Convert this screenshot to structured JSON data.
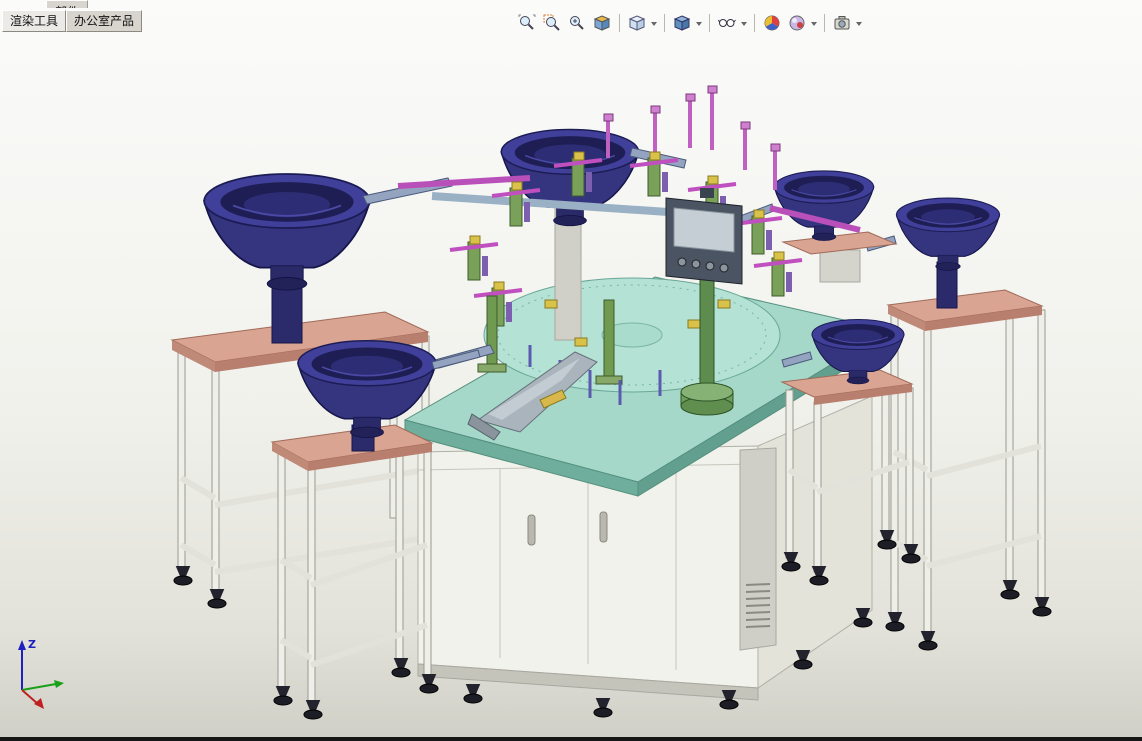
{
  "tabs": [
    {
      "label": "渲染工具"
    },
    {
      "label": "办公室产品"
    }
  ],
  "top_fragment": {
    "label": "部件"
  },
  "toolbar": {
    "items": [
      {
        "name": "zoom-to-fit-icon",
        "glyph": "magnifier"
      },
      {
        "name": "zoom-to-area-icon",
        "glyph": "magnifier-with-area"
      },
      {
        "name": "zoom-in-out-icon",
        "glyph": "magnifier-with-plus"
      },
      {
        "name": "section-view-icon",
        "glyph": "cube-cut"
      },
      {
        "name": "view-orientation-icon",
        "glyph": "cube",
        "dropdown": true
      },
      {
        "name": "display-style-icon",
        "glyph": "shaded-cube",
        "dropdown": true
      },
      {
        "name": "hide-show-items-icon",
        "glyph": "glasses",
        "dropdown": true
      },
      {
        "name": "edit-appearance-icon",
        "glyph": "color-sphere"
      },
      {
        "name": "apply-scene-icon",
        "glyph": "scene-sphere",
        "dropdown": true
      },
      {
        "name": "view-settings-icon",
        "glyph": "camera",
        "dropdown": true
      }
    ]
  },
  "triad": {
    "z_label": "Z"
  },
  "colors": {
    "background": "#f0f0ec",
    "bowl_rim": "#40409a",
    "bowl_inner": "#1e1e55",
    "bowl_body": "#35357f",
    "table_top": "#a6d8c9",
    "table_edge": "#6fae9c",
    "stand_top": "#d9a492",
    "cabinet_front": "#f2f2ec",
    "cabinet_side": "#e3e3d9",
    "fixture_green": "#79a159",
    "fixture_magenta": "#c04fc0",
    "pole_green": "#5d8c4e",
    "panel_body": "#4a5462",
    "screen": "#c4ced4"
  }
}
